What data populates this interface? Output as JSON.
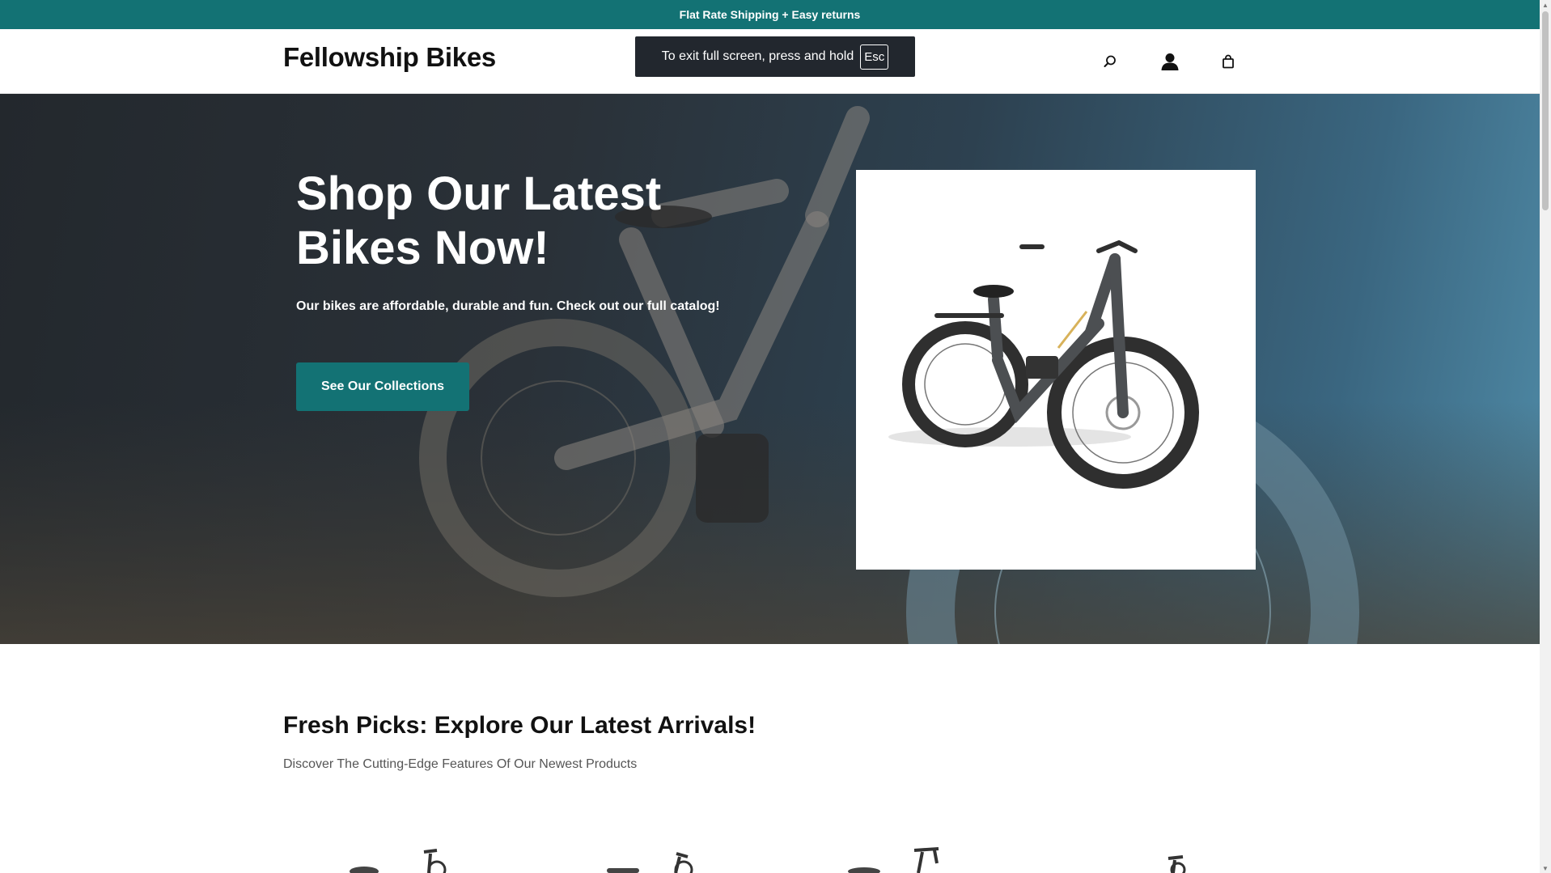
{
  "announcement": {
    "text": "Flat Rate Shipping + Easy returns"
  },
  "header": {
    "logo": "Fellowship Bikes",
    "icons": [
      "search-icon",
      "account-icon",
      "cart-icon"
    ]
  },
  "fullscreen_toast": {
    "text": "To exit full screen, press and hold",
    "key": "Esc"
  },
  "hero": {
    "title": "Shop Our Latest Bikes Now!",
    "subtitle": "Our bikes are affordable, durable and fun. Check out our full catalog!",
    "button_label": "See Our Collections"
  },
  "fresh_picks": {
    "title": "Fresh Picks: Explore Our Latest Arrivals!",
    "subtitle": "Discover The Cutting-Edge Features Of Our Newest Products"
  },
  "colors": {
    "accent": "#137274",
    "toast": "#22272e"
  }
}
